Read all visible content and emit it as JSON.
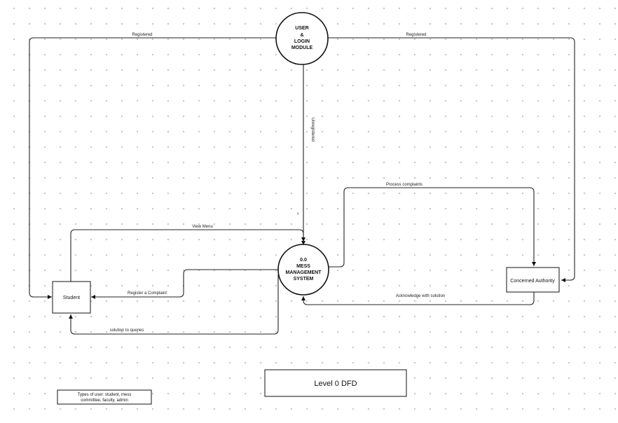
{
  "diagram": {
    "processes": {
      "user_login": {
        "lines": [
          "USER",
          "&",
          "LOGIN",
          "MODULE"
        ]
      },
      "mess_system": {
        "lines": [
          "0.0",
          "MESS",
          "MANAGEMENT",
          "SYSTEM"
        ]
      }
    },
    "entities": {
      "student": {
        "label": "Student"
      },
      "authority": {
        "label": "Concerned Authority"
      }
    },
    "flows": {
      "registered_left": "Registered",
      "registered_right": "Registered",
      "unregistered": "Unregistered",
      "view_menu": "View Menu",
      "register_complaint": "Register a Complaint",
      "solution_queries": "solution to queries",
      "process_complaints": "Process complaints",
      "acknowledge": "Acknowledge with solution",
      "stray_mark": "≈"
    },
    "title": "Level 0 DFD",
    "note": {
      "line1": "Types of user: student, mess",
      "line2": "committee, faculty, admin"
    }
  }
}
